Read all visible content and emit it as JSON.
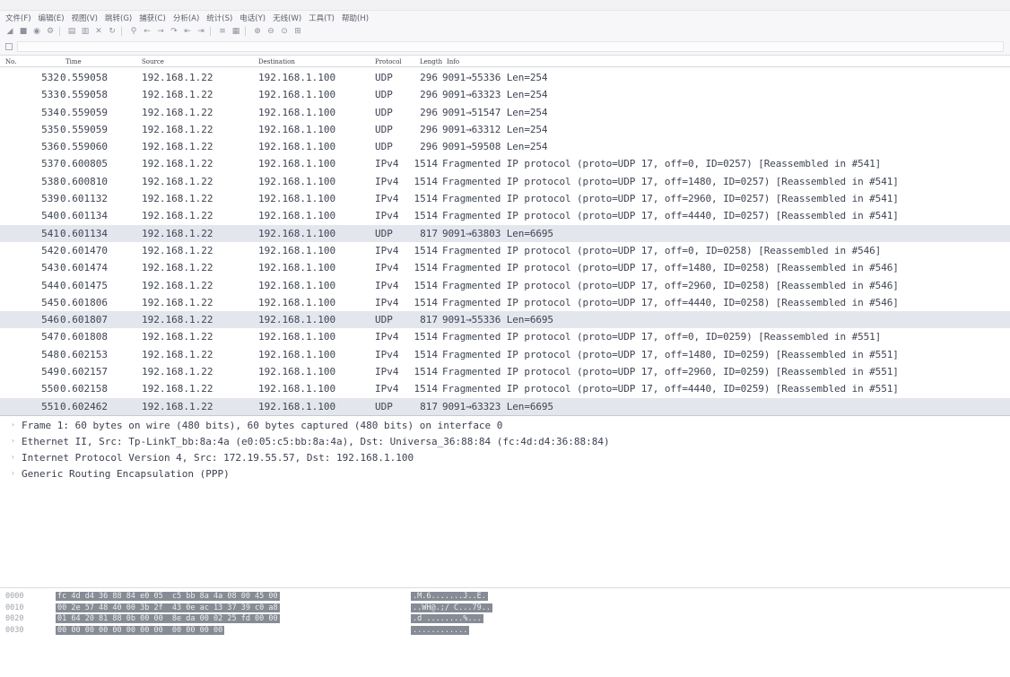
{
  "title": "",
  "menu": [
    "文件(F)",
    "编辑(E)",
    "视图(V)",
    "跳转(G)",
    "捕获(C)",
    "分析(A)",
    "统计(S)",
    "电话(Y)",
    "无线(W)",
    "工具(T)",
    "帮助(H)"
  ],
  "toolbar_icons": [
    "shark-fin-start-icon",
    "stop-square-icon",
    "restart-icon",
    "gear-options-icon",
    "open-file-icon",
    "save-file-icon",
    "close-file-icon",
    "reload-icon",
    "find-icon",
    "go-back-icon",
    "go-forward-icon",
    "go-to-packet-icon",
    "first-packet-icon",
    "last-packet-icon",
    "autoscroll-icon",
    "colorize-icon",
    "zoom-in-icon",
    "zoom-out-icon",
    "zoom-normal-icon",
    "resize-columns-icon"
  ],
  "filter": {
    "placeholder": "",
    "value": ""
  },
  "columns": {
    "no": "No.",
    "time": "Time",
    "source": "Source",
    "destination": "Destination",
    "protocol": "Protocol",
    "length": "Length",
    "info": "Info"
  },
  "packets": [
    {
      "no": "532",
      "time": "0.559058",
      "src": "192.168.1.22",
      "dst": "192.168.1.100",
      "proto": "UDP",
      "len": "296",
      "info": "9091→55336 Len=254"
    },
    {
      "no": "533",
      "time": "0.559058",
      "src": "192.168.1.22",
      "dst": "192.168.1.100",
      "proto": "UDP",
      "len": "296",
      "info": "9091→63323 Len=254"
    },
    {
      "no": "534",
      "time": "0.559059",
      "src": "192.168.1.22",
      "dst": "192.168.1.100",
      "proto": "UDP",
      "len": "296",
      "info": "9091→51547 Len=254"
    },
    {
      "no": "535",
      "time": "0.559059",
      "src": "192.168.1.22",
      "dst": "192.168.1.100",
      "proto": "UDP",
      "len": "296",
      "info": "9091→63312 Len=254"
    },
    {
      "no": "536",
      "time": "0.559060",
      "src": "192.168.1.22",
      "dst": "192.168.1.100",
      "proto": "UDP",
      "len": "296",
      "info": "9091→59508 Len=254"
    },
    {
      "no": "537",
      "time": "0.600805",
      "src": "192.168.1.22",
      "dst": "192.168.1.100",
      "proto": "IPv4",
      "len": "1514",
      "info": "Fragmented IP protocol (proto=UDP 17, off=0, ID=0257) [Reassembled in #541]"
    },
    {
      "no": "538",
      "time": "0.600810",
      "src": "192.168.1.22",
      "dst": "192.168.1.100",
      "proto": "IPv4",
      "len": "1514",
      "info": "Fragmented IP protocol (proto=UDP 17, off=1480, ID=0257) [Reassembled in #541]"
    },
    {
      "no": "539",
      "time": "0.601132",
      "src": "192.168.1.22",
      "dst": "192.168.1.100",
      "proto": "IPv4",
      "len": "1514",
      "info": "Fragmented IP protocol (proto=UDP 17, off=2960, ID=0257) [Reassembled in #541]"
    },
    {
      "no": "540",
      "time": "0.601134",
      "src": "192.168.1.22",
      "dst": "192.168.1.100",
      "proto": "IPv4",
      "len": "1514",
      "info": "Fragmented IP protocol (proto=UDP 17, off=4440, ID=0257) [Reassembled in #541]"
    },
    {
      "no": "541",
      "time": "0.601134",
      "src": "192.168.1.22",
      "dst": "192.168.1.100",
      "proto": "UDP",
      "len": "817",
      "info": "9091→63803 Len=6695"
    },
    {
      "no": "542",
      "time": "0.601470",
      "src": "192.168.1.22",
      "dst": "192.168.1.100",
      "proto": "IPv4",
      "len": "1514",
      "info": "Fragmented IP protocol (proto=UDP 17, off=0, ID=0258) [Reassembled in #546]"
    },
    {
      "no": "543",
      "time": "0.601474",
      "src": "192.168.1.22",
      "dst": "192.168.1.100",
      "proto": "IPv4",
      "len": "1514",
      "info": "Fragmented IP protocol (proto=UDP 17, off=1480, ID=0258) [Reassembled in #546]"
    },
    {
      "no": "544",
      "time": "0.601475",
      "src": "192.168.1.22",
      "dst": "192.168.1.100",
      "proto": "IPv4",
      "len": "1514",
      "info": "Fragmented IP protocol (proto=UDP 17, off=2960, ID=0258) [Reassembled in #546]"
    },
    {
      "no": "545",
      "time": "0.601806",
      "src": "192.168.1.22",
      "dst": "192.168.1.100",
      "proto": "IPv4",
      "len": "1514",
      "info": "Fragmented IP protocol (proto=UDP 17, off=4440, ID=0258) [Reassembled in #546]"
    },
    {
      "no": "546",
      "time": "0.601807",
      "src": "192.168.1.22",
      "dst": "192.168.1.100",
      "proto": "UDP",
      "len": "817",
      "info": "9091→55336 Len=6695"
    },
    {
      "no": "547",
      "time": "0.601808",
      "src": "192.168.1.22",
      "dst": "192.168.1.100",
      "proto": "IPv4",
      "len": "1514",
      "info": "Fragmented IP protocol (proto=UDP 17, off=0, ID=0259) [Reassembled in #551]"
    },
    {
      "no": "548",
      "time": "0.602153",
      "src": "192.168.1.22",
      "dst": "192.168.1.100",
      "proto": "IPv4",
      "len": "1514",
      "info": "Fragmented IP protocol (proto=UDP 17, off=1480, ID=0259) [Reassembled in #551]"
    },
    {
      "no": "549",
      "time": "0.602157",
      "src": "192.168.1.22",
      "dst": "192.168.1.100",
      "proto": "IPv4",
      "len": "1514",
      "info": "Fragmented IP protocol (proto=UDP 17, off=2960, ID=0259) [Reassembled in #551]"
    },
    {
      "no": "550",
      "time": "0.602158",
      "src": "192.168.1.22",
      "dst": "192.168.1.100",
      "proto": "IPv4",
      "len": "1514",
      "info": "Fragmented IP protocol (proto=UDP 17, off=4440, ID=0259) [Reassembled in #551]"
    },
    {
      "no": "551",
      "time": "0.602462",
      "src": "192.168.1.22",
      "dst": "192.168.1.100",
      "proto": "UDP",
      "len": "817",
      "info": "9091→63323 Len=6695"
    }
  ],
  "tinted_rows": [
    "541",
    "546",
    "551"
  ],
  "details": [
    "Frame 1: 60 bytes on wire (480 bits), 60 bytes captured (480 bits) on interface 0",
    "Ethernet II, Src: Tp-LinkT_bb:8a:4a (e0:05:c5:bb:8a:4a), Dst: Universa_36:88:84 (fc:4d:d4:36:88:84)",
    "Internet Protocol Version 4, Src: 172.19.55.57, Dst: 192.168.1.100",
    "Generic Routing Encapsulation (PPP)"
  ],
  "hex": [
    {
      "offset": "0000",
      "bytes": "fc 4d d4 36 88 84 e0 05  c5 bb 8a 4a 08 00 45 00",
      "ascii": ".M.6.......J..E."
    },
    {
      "offset": "0010",
      "bytes": "00 2e 57 48 40 00 3b 2f  43 0e ac 13 37 39 c0 a8",
      "ascii": "..WH@.;/ C...79.."
    },
    {
      "offset": "0020",
      "bytes": "01 64 20 81 88 0b 00 00  8e da 00 02 25 fd 00 00",
      "ascii": ".d ........%..."
    },
    {
      "offset": "0030",
      "bytes": "00 00 00 00 00 00 00 00  00 00 00 00",
      "ascii": "............"
    }
  ],
  "colors": {
    "tinted_row": "#e4e6ee",
    "hex_highlight": "#878b95"
  }
}
